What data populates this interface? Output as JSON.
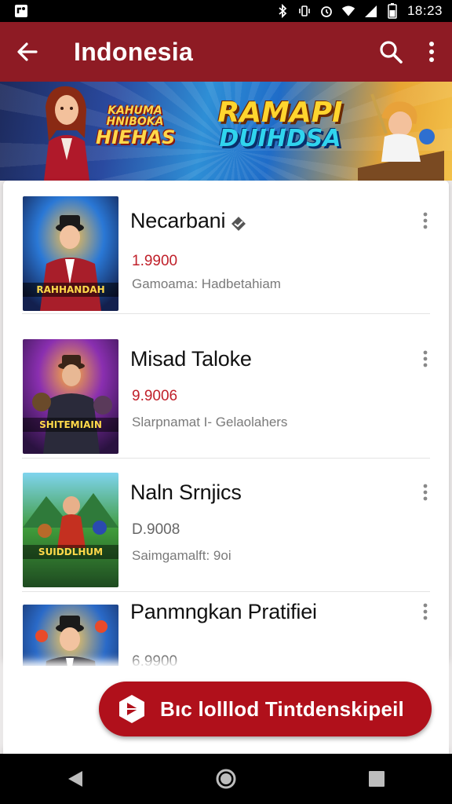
{
  "status_bar": {
    "time": "18:23",
    "icons": [
      "app-notification-icon",
      "bluetooth-icon",
      "vibrate-icon",
      "alarm-icon",
      "wifi-icon",
      "signal-icon",
      "battery-icon"
    ]
  },
  "app_bar": {
    "title": "Indonesia",
    "back_icon": "arrow-left-icon",
    "search_icon": "search-icon",
    "menu_icon": "more-vert-icon",
    "color": "#8e1b24"
  },
  "banner": {
    "left_logo": [
      "KAHUMA",
      "HNIBOKA",
      "HIEHAS"
    ],
    "title_line1": "RAMAPI",
    "title_line2": "DUIHDSA"
  },
  "items": [
    {
      "title": "Necarbani",
      "verified": true,
      "price": "1.9900",
      "subtitle": "Gamoama: Hadbetahiam",
      "thumb_caption": "RAHHANDAH"
    },
    {
      "title": "Misad Taloke",
      "verified": false,
      "price": "9.9006",
      "subtitle": "Slarpnamat I- Gelaolahers",
      "thumb_caption": "SHITEMIAIN"
    },
    {
      "title": "Naln Srnjics",
      "verified": false,
      "price": "D.9008",
      "subtitle": "Saimgamalft: 9oi",
      "thumb_caption": "SUIDDLHUM"
    },
    {
      "title": "Panmngkan Pratifiei",
      "verified": false,
      "price": "6.9900",
      "subtitle": "",
      "thumb_caption": ""
    }
  ],
  "download_button": {
    "label": "Bıc lolllod  Tintdenskipeil",
    "color": "#b0101b"
  },
  "nav_bar": {
    "icons": [
      "back-triangle-icon",
      "home-circle-icon",
      "recents-square-icon"
    ]
  },
  "colors": {
    "accent": "#8e1b24",
    "price_red": "#c0202a"
  }
}
